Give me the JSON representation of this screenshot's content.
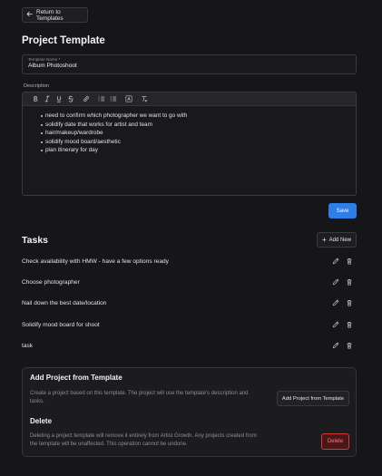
{
  "header": {
    "back_label": "Return to Templates",
    "title": "Project Template"
  },
  "form": {
    "name_label": "Template Name *",
    "name_value": "Album Photoshoot",
    "description_label": "Description",
    "description_items": [
      "need to confirm which photographer we want to go with",
      "solidify date that works for artist and team",
      "hair/makeup/wardrobe",
      "solidify mood board/aesthetic",
      "plan itinerary for day"
    ],
    "toolbar_icons": [
      "bold-icon",
      "italic-icon",
      "underline-icon",
      "strikethrough-icon",
      "link-icon",
      "ordered-list-icon",
      "bullet-list-icon",
      "text-color-icon",
      "clear-format-icon"
    ],
    "save_label": "Save"
  },
  "tasks": {
    "title": "Tasks",
    "add_label": "Add New",
    "items": [
      "Check availability with HMW - have a few options ready",
      "Choose photographer",
      "Nail down the best date/location",
      "Solidify mood board for shoot",
      "task"
    ]
  },
  "add_project": {
    "title": "Add Project from Template",
    "description": "Create a project based on this template. The project will use the template's description and tasks.",
    "button_label": "Add Project from Template"
  },
  "delete": {
    "title": "Delete",
    "description": "Deleting a project template will remove it entirely from Artist Growth. Any projects created from the template will be unaffected. This operation cannot be undone.",
    "button_label": "Delete"
  },
  "colors": {
    "background": "#161618",
    "accent": "#2f7de6",
    "danger": "#d23b3b"
  }
}
